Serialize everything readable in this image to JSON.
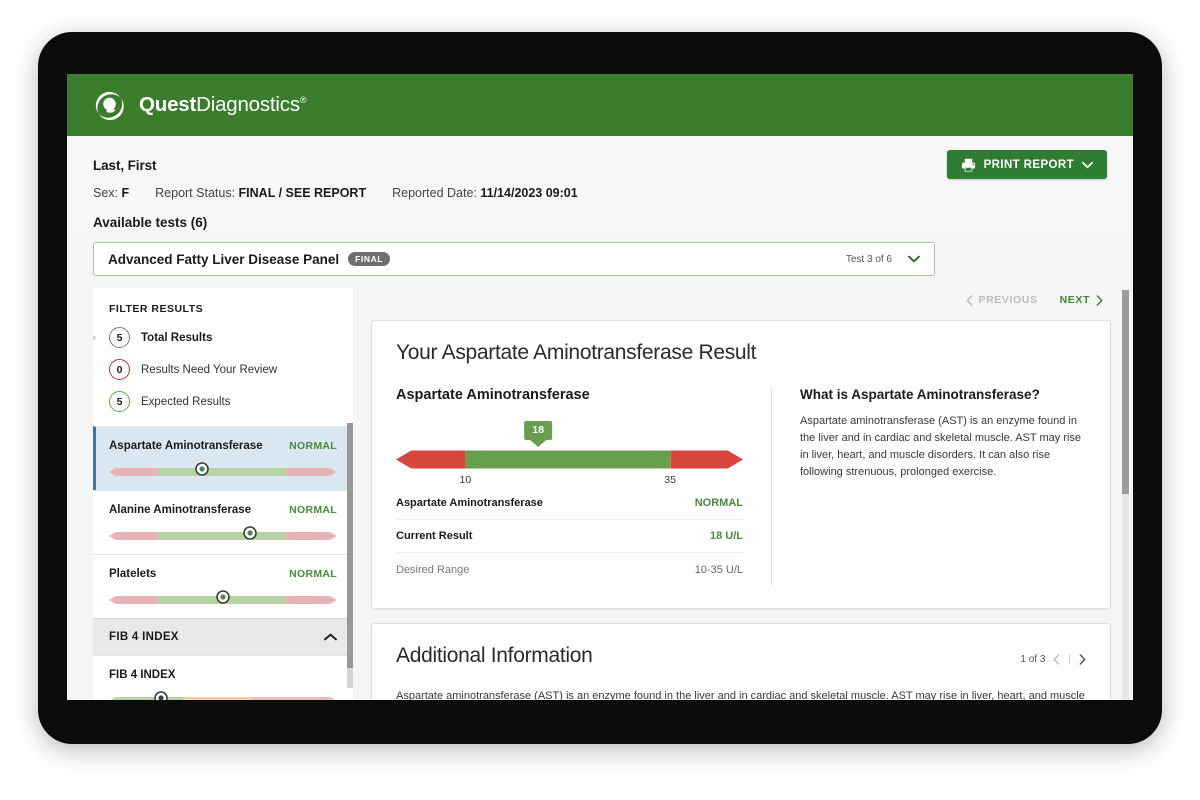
{
  "brand": {
    "name_bold": "Quest",
    "name_light": "Diagnostics",
    "registered": "®",
    "header_color": "#3a7d2c"
  },
  "patient": {
    "name": "Last, First",
    "sex_label": "Sex:",
    "sex_value": "F",
    "report_status_label": "Report Status:",
    "report_status_value": "FINAL / SEE REPORT",
    "reported_date_label": "Reported Date:",
    "reported_date_value": "11/14/2023 09:01",
    "available_tests": "Available tests (6)"
  },
  "toolbar": {
    "print_label": "PRINT REPORT",
    "print_icon": "printer-icon",
    "caret_icon": "chevron-down-icon"
  },
  "panel_selector": {
    "title": "Advanced Fatty Liver Disease Panel",
    "status_chip": "FINAL",
    "test_count": "Test 3 of 6",
    "caret_icon": "chevron-down-icon"
  },
  "sidebar": {
    "filter_title": "FILTER RESULTS",
    "filters": [
      {
        "count": "5",
        "label": "Total Results",
        "selected": true,
        "ring": "gray"
      },
      {
        "count": "0",
        "label": "Results Need Your Review",
        "selected": false,
        "ring": "red"
      },
      {
        "count": "5",
        "label": "Expected Results",
        "selected": false,
        "ring": "green"
      }
    ],
    "results": [
      {
        "name": "Aspartate Aminotransferase",
        "status": "NORMAL",
        "active": true,
        "marker_pct": 41,
        "segments": "normal"
      },
      {
        "name": "Alanine Aminotransferase",
        "status": "NORMAL",
        "active": false,
        "marker_pct": 62,
        "segments": "normal"
      },
      {
        "name": "Platelets",
        "status": "NORMAL",
        "active": false,
        "marker_pct": 50,
        "segments": "normal"
      }
    ],
    "section": {
      "title": "FIB 4 INDEX",
      "chevron_icon": "chevron-up-icon",
      "item_name": "FIB 4 INDEX",
      "marker_pct": 23
    }
  },
  "navigation": {
    "previous_label": "PREVIOUS",
    "next_label": "NEXT",
    "previous_enabled": false,
    "next_enabled": true
  },
  "result_card": {
    "title": "Your Aspartate Aminotransferase Result",
    "analyte": "Aspartate Aminotransferase",
    "rows": [
      {
        "key": "Aspartate Aminotransferase",
        "value": "NORMAL",
        "style": "green"
      },
      {
        "key": "Current Result",
        "value": "18 U/L",
        "style": "green"
      },
      {
        "key": "Desired Range",
        "value": "10-35 U/L",
        "style": "muted"
      }
    ],
    "info_heading": "What is Aspartate Aminotransferase?",
    "info_text": "Aspartate aminotransferase (AST) is an enzyme found in the liver and in cardiac and skeletal muscle. AST may rise in liver, heart, and muscle disorders. It can also rise following strenuous, prolonged exercise."
  },
  "additional_info": {
    "title": "Additional Information",
    "pager_text": "1 of 3",
    "prev_icon": "chevron-left-icon",
    "next_icon": "chevron-right-icon",
    "body": "Aspartate aminotransferase (AST) is an enzyme found in the liver and in cardiac and skeletal muscle. AST may rise in liver, heart, and muscle disorders. It can also rise following strenuous, prolonged exercise."
  },
  "chart_data": {
    "type": "bar",
    "title": "Aspartate Aminotransferase reference range gauge",
    "unit": "U/L",
    "value": 18,
    "value_label": "18",
    "range_low": 10,
    "range_high": 35,
    "tick_labels": [
      "10",
      "35"
    ],
    "tick_values": [
      10,
      35
    ],
    "marker_position_pct": 41,
    "low_segment_pct": 20,
    "normal_segment_pct": 59,
    "high_segment_pct": 21,
    "segments": [
      {
        "name": "Low",
        "color": "#d9453f",
        "from_pct": 0,
        "to_pct": 20
      },
      {
        "name": "Normal",
        "color": "#6a9e4f",
        "from_pct": 20,
        "to_pct": 79
      },
      {
        "name": "High",
        "color": "#d9453f",
        "from_pct": 79,
        "to_pct": 100
      }
    ],
    "status": "NORMAL"
  },
  "colors": {
    "brand_green": "#3a7d2c",
    "button_green": "#2f7d32",
    "status_green": "#4a8c3f",
    "gauge_red": "#d9453f",
    "gauge_green": "#6a9e4f",
    "mini_pink": "#e5b4b4",
    "mini_green": "#b5d3a6",
    "mini_orange": "#f7cda0",
    "active_blue": "#dae6f0",
    "active_border": "#3f76a8"
  }
}
